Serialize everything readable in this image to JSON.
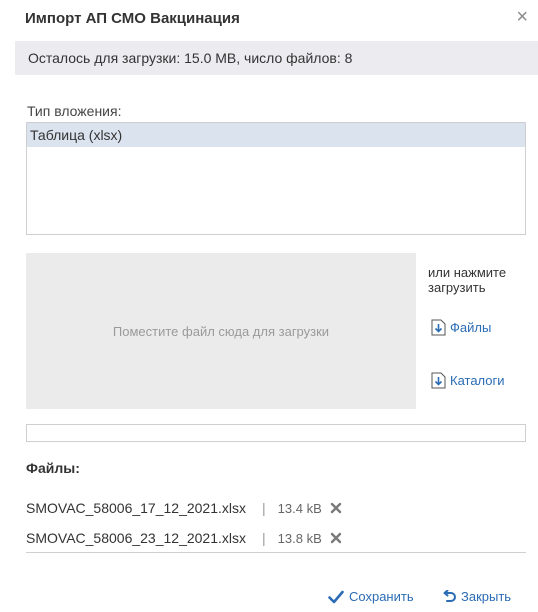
{
  "dialog": {
    "title": "Импорт АП СМО Вакцинация",
    "close_glyph": "×"
  },
  "quota": {
    "text": "Осталось для загрузки: 15.0 MB, число файлов: 8"
  },
  "attachment": {
    "label": "Тип вложения:",
    "options": [
      "Таблица (xlsx)"
    ],
    "selected_index": 0
  },
  "dropzone": {
    "hint": "Поместите файл сюда для загрузки"
  },
  "upload": {
    "or_hint": "или нажмите загрузить",
    "files_label": "Файлы",
    "dirs_label": "Каталоги",
    "icon": "upload-icon"
  },
  "progress": {
    "value": 0
  },
  "files": {
    "heading": "Файлы:",
    "separator": "|",
    "items": [
      {
        "name": "SMOVAC_58006_17_12_2021.xlsx",
        "size": "13.4 kB"
      },
      {
        "name": "SMOVAC_58006_23_12_2021.xlsx",
        "size": "13.8 kB"
      }
    ]
  },
  "footer": {
    "save_label": "Сохранить",
    "close_label": "Закрыть",
    "save_icon": "checkmark-icon",
    "close_icon": "undo-icon"
  },
  "colors": {
    "link": "#2b6cb5",
    "selection": "#dbe3ee",
    "quota_bg": "#ececf0",
    "dropzone_bg": "#ebebeb"
  }
}
